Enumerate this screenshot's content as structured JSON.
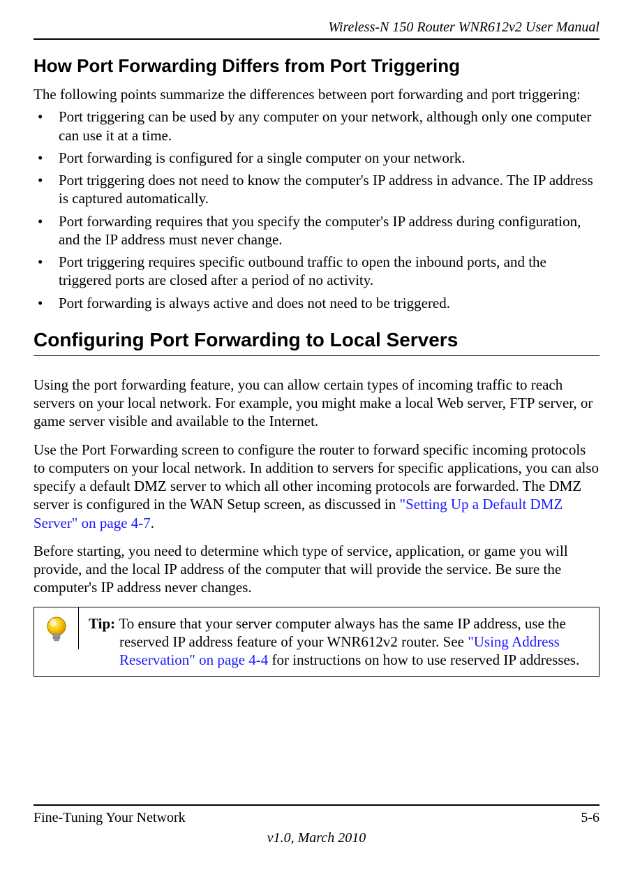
{
  "header": {
    "doc_title": "Wireless-N 150 Router WNR612v2 User Manual"
  },
  "section1": {
    "heading": "How Port Forwarding Differs from Port Triggering",
    "intro": "The following points summarize the differences between port forwarding and port triggering:",
    "bullets": [
      "Port triggering can be used by any computer on your network, although only one computer can use it at a time.",
      "Port forwarding is configured for a single computer on your network.",
      "Port triggering does not need to know the computer's IP address in advance. The IP address is captured automatically.",
      "Port forwarding requires that you specify the computer's IP address during configuration, and the IP address must never change.",
      "Port triggering requires specific outbound traffic to open the inbound ports, and the triggered ports are closed after a period of no activity.",
      "Port forwarding is always active and does not need to be triggered."
    ]
  },
  "section2": {
    "heading": "Configuring Port Forwarding to Local Servers",
    "para1": "Using the port forwarding feature, you can allow certain types of incoming traffic to reach servers on your local network. For example, you might make a local Web server, FTP server, or game server visible and available to the Internet.",
    "para2_pre": "Use the Port Forwarding screen to configure the router to forward specific incoming protocols to computers on your local network. In addition to servers for specific applications, you can also specify a default DMZ server to which all other incoming protocols are forwarded. The DMZ server is configured in the WAN Setup screen, as discussed in ",
    "para2_link": "\"Setting Up a Default DMZ Server\" on page 4-7",
    "para2_post": ".",
    "para3": "Before starting, you need to determine which type of service, application, or game you will provide, and the local IP address of the computer that will provide the service. Be sure the computer's IP address never changes."
  },
  "tip": {
    "label": "Tip: ",
    "text_pre": "To ensure that your server computer always has the same IP address, use the reserved IP address feature of your WNR612v2 router. See ",
    "link": "\"Using Address Reservation\" on page 4-4",
    "text_post": " for instructions on how to use reserved IP addresses."
  },
  "footer": {
    "chapter": "Fine-Tuning Your Network",
    "page": "5-6",
    "version": "v1.0, March 2010"
  }
}
